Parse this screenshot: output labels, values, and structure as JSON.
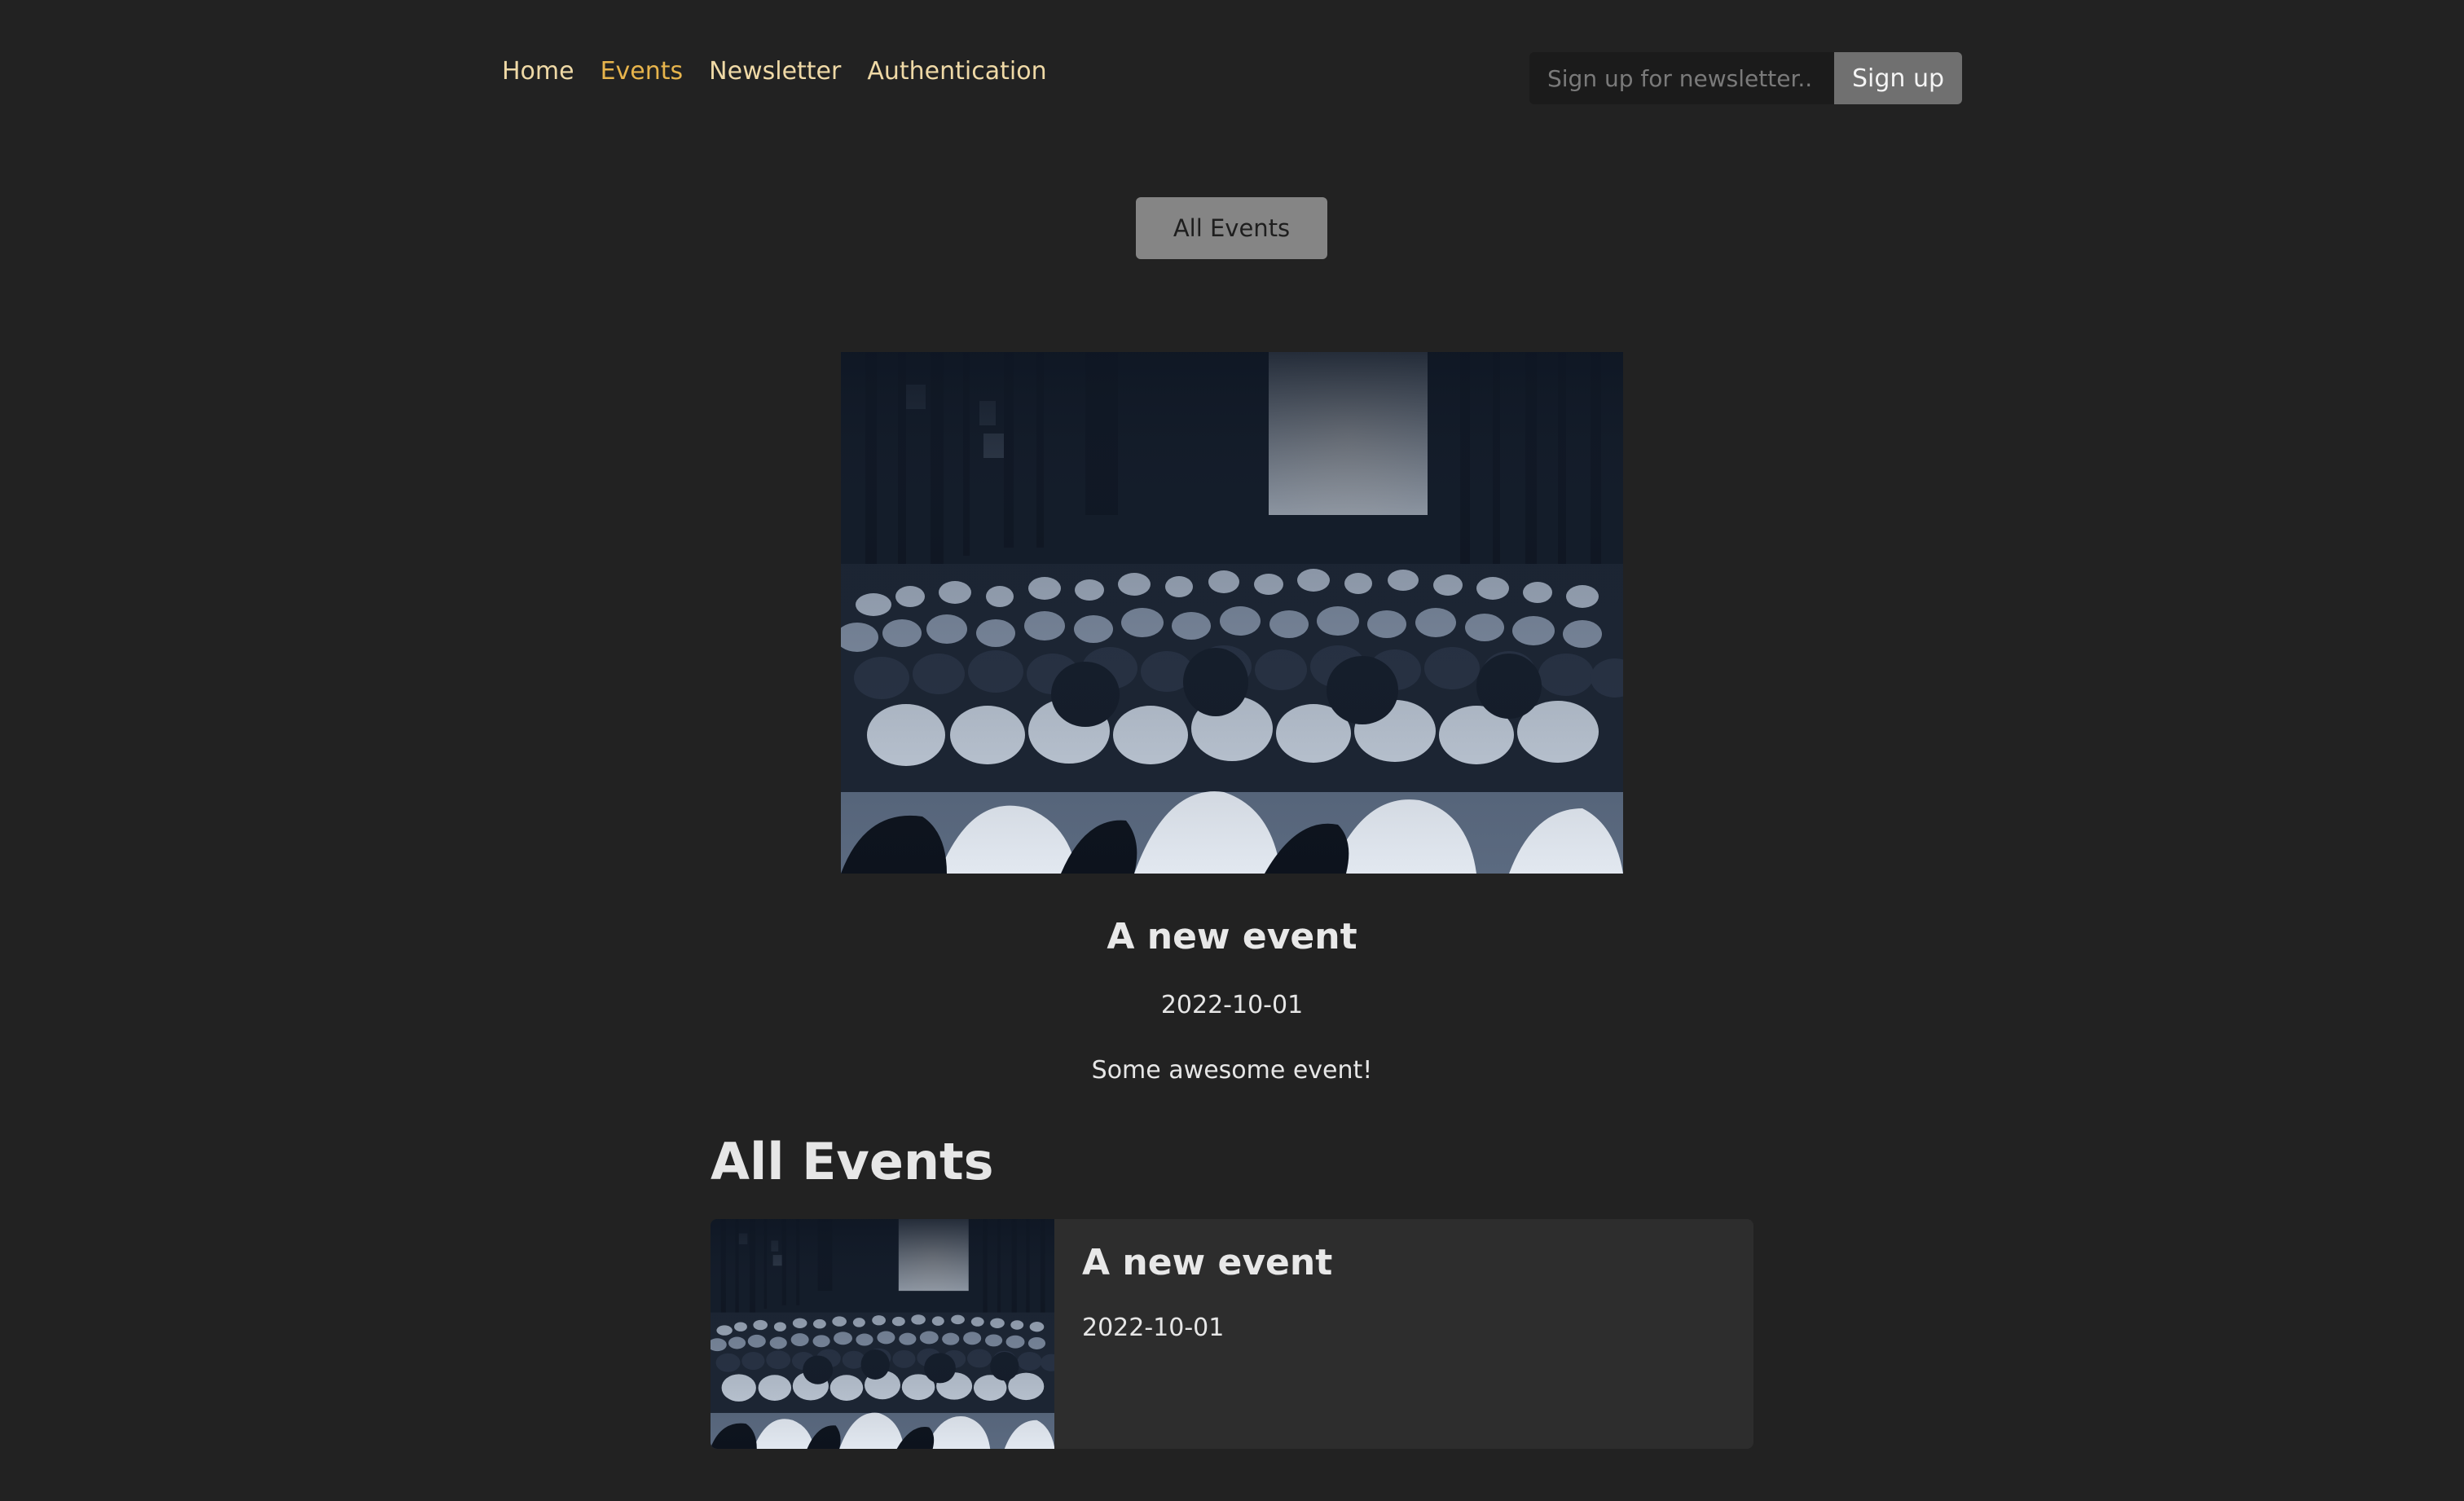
{
  "nav": {
    "items": [
      {
        "label": "Home",
        "active": false
      },
      {
        "label": "Events",
        "active": true
      },
      {
        "label": "Newsletter",
        "active": false
      },
      {
        "label": "Authentication",
        "active": false
      }
    ]
  },
  "newsletter": {
    "placeholder": "Sign up for newsletter..",
    "button_label": "Sign up"
  },
  "all_events_button": "All Events",
  "featured_event": {
    "image": "conference-audience-photo",
    "title": "A new event",
    "date": "2022-10-01",
    "description": "Some awesome event!"
  },
  "list": {
    "title": "All Events",
    "events": [
      {
        "image": "conference-audience-photo",
        "title": "A new event",
        "date": "2022-10-01"
      }
    ]
  },
  "colors": {
    "background": "#222222",
    "nav_link": "#efd9a6",
    "nav_link_active": "#e7b44c",
    "card_background": "#2d2d2d",
    "button_gray": "#858585"
  }
}
